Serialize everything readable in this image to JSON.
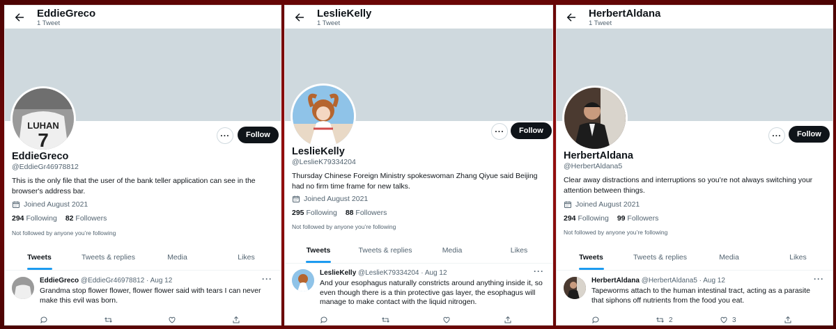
{
  "panels": [
    {
      "header": {
        "name": "EddieGreco",
        "sub": "1 Tweet"
      },
      "follow_label": "Follow",
      "more_label": "···",
      "profile": {
        "name": "EddieGreco",
        "handle": "@EddieGr46978812",
        "bio": "This is the only file that the user of the bank teller application can see in the browser's address bar.",
        "joined": "Joined August 2021",
        "following_count": "294",
        "following_label": "Following",
        "followers_count": "82",
        "followers_label": "Followers",
        "not_followed": "Not followed by anyone you’re following"
      },
      "tabs": [
        "Tweets",
        "Tweets & replies",
        "Media",
        "Likes"
      ],
      "tweet": {
        "name": "EddieGreco",
        "meta": "@EddieGr46978812 · Aug 12",
        "text": "Grandma stop flower flower, flower flower said with tears I can never make this evil was born.",
        "retweets": "",
        "likes": ""
      }
    },
    {
      "header": {
        "name": "LeslieKelly",
        "sub": "1 Tweet"
      },
      "follow_label": "Follow",
      "more_label": "···",
      "profile": {
        "name": "LeslieKelly",
        "handle": "@LeslieK79334204",
        "bio": "Thursday Chinese Foreign Ministry spokeswoman Zhang Qiyue said Beijing had no firm time frame for new talks.",
        "joined": "Joined August 2021",
        "following_count": "295",
        "following_label": "Following",
        "followers_count": "88",
        "followers_label": "Followers",
        "not_followed": "Not followed by anyone you’re following"
      },
      "tabs": [
        "Tweets",
        "Tweets & replies",
        "Media",
        "Likes"
      ],
      "tweet": {
        "name": "LeslieKelly",
        "meta": "@LeslieK79334204 · Aug 12",
        "text": "And your esophagus naturally constricts around anything inside it, so even though there is a thin protective gas layer, the esophagus will manage to make contact with the liquid nitrogen.",
        "retweets": "",
        "likes": ""
      }
    },
    {
      "header": {
        "name": "HerbertAldana",
        "sub": "1 Tweet"
      },
      "follow_label": "Follow",
      "more_label": "···",
      "profile": {
        "name": "HerbertAldana",
        "handle": "@HerbertAldana5",
        "bio": "Clear away distractions and interruptions so you’re not always switching your attention between things.",
        "joined": "Joined August 2021",
        "following_count": "294",
        "following_label": "Following",
        "followers_count": "99",
        "followers_label": "Followers",
        "not_followed": "Not followed by anyone you’re following"
      },
      "tabs": [
        "Tweets",
        "Tweets & replies",
        "Media",
        "Likes"
      ],
      "tweet": {
        "name": "HerbertAldana",
        "meta": "@HerbertAldana5 · Aug 12",
        "text": "Tapeworms attach to the human intestinal tract, acting as a parasite that siphons off nutrients from the food you eat.",
        "retweets": "2",
        "likes": "3"
      }
    }
  ],
  "avatar_text": {
    "jersey_name": "LUHAN",
    "jersey_number": "7"
  },
  "colors": {
    "accent": "#1d9bf0",
    "banner": "#cfd9de",
    "frame": "#9a0d0d",
    "follow_bg": "#0f1419"
  }
}
